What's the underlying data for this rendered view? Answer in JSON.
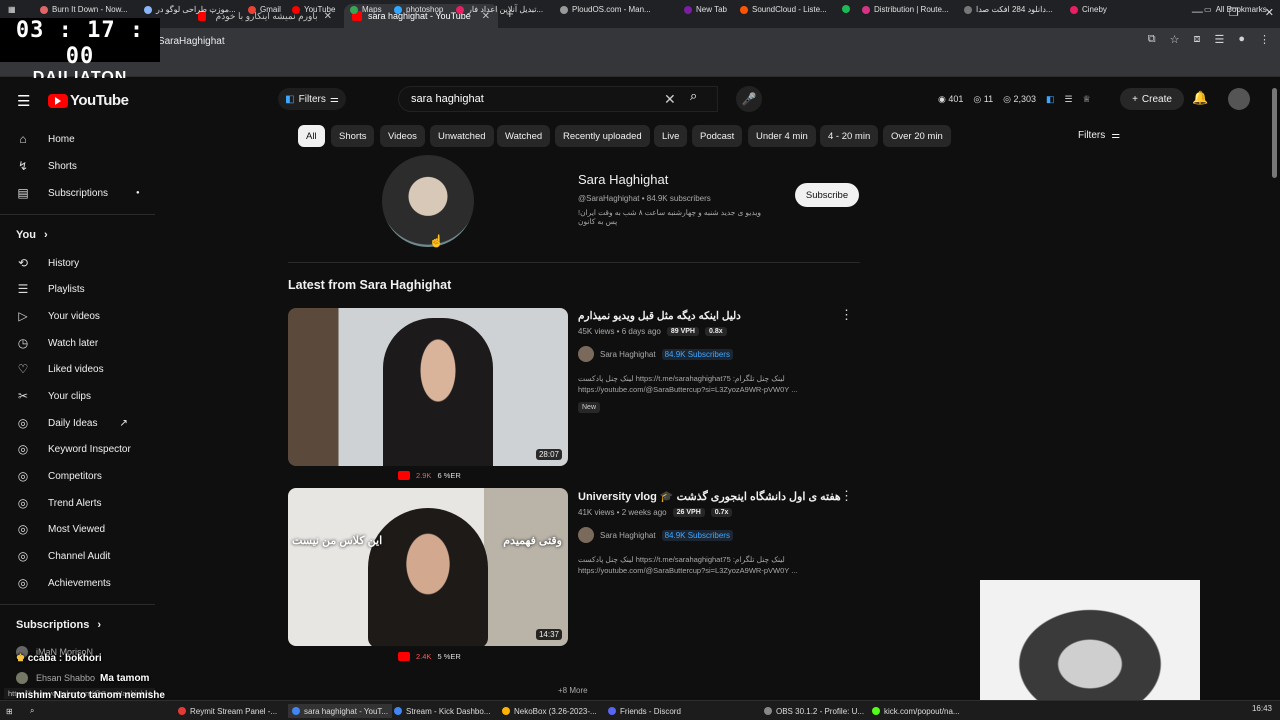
{
  "browser": {
    "tabs": [
      {
        "label": "باورم نمیشه اینکارو با خودم کرد..."
      },
      {
        "label": "sara haghighat - YouTube"
      }
    ],
    "new_tab": "+",
    "url": "/@SaraHaghighat",
    "bookmarks": [
      "Burn It Down - Now...",
      "موزت طراحی لوگو در...",
      "Gmail",
      "YouTube",
      "Maps",
      "photoshop",
      "تبدیل آنلاین اعداد فار...",
      "PloudOS.com - Man...",
      "New Tab",
      "SoundCloud - Liste...",
      "Distribution | Route...",
      "دانلود 284 افکت صدا...",
      "Cineby"
    ],
    "all_bookmarks": "All Bookmarks"
  },
  "overlay": {
    "timer": "03 : 17 : 00",
    "label": "DAILIATON"
  },
  "header": {
    "logo": "YouTube",
    "filters_btn": "Filters",
    "search_value": "sara haghighat",
    "stats": [
      "401",
      "11",
      "2,303"
    ],
    "create": "Create"
  },
  "sidebar": {
    "main": [
      {
        "label": "Home",
        "icon": "home-icon",
        "glyph": "⌂"
      },
      {
        "label": "Shorts",
        "icon": "shorts-icon",
        "glyph": "↯"
      },
      {
        "label": "Subscriptions",
        "icon": "subscriptions-icon",
        "glyph": "▤"
      }
    ],
    "you_header": "You",
    "you": [
      {
        "label": "History",
        "glyph": "⟲"
      },
      {
        "label": "Playlists",
        "glyph": "☰"
      },
      {
        "label": "Your videos",
        "glyph": "▷"
      },
      {
        "label": "Watch later",
        "glyph": "◷"
      },
      {
        "label": "Liked videos",
        "glyph": "👍"
      },
      {
        "label": "Your clips",
        "glyph": "✂"
      },
      {
        "label": "Daily Ideas",
        "glyph": "◎"
      },
      {
        "label": "Keyword Inspector",
        "glyph": "◎"
      },
      {
        "label": "Competitors",
        "glyph": "◎"
      },
      {
        "label": "Trend Alerts",
        "glyph": "◎"
      },
      {
        "label": "Most Viewed",
        "glyph": "◎"
      },
      {
        "label": "Channel Audit",
        "glyph": "◎"
      },
      {
        "label": "Achievements",
        "glyph": "◎"
      }
    ],
    "subs_header": "Subscriptions",
    "sub_item": "iMaN MorisoN",
    "sub_item2": "Ehsan Shabbo"
  },
  "chips": [
    "All",
    "Shorts",
    "Videos",
    "Unwatched",
    "Watched",
    "Recently uploaded",
    "Live",
    "Podcast",
    "Under 4 min",
    "4 - 20 min",
    "Over 20 min"
  ],
  "filters_right": "Filters",
  "channel": {
    "name": "Sara Haghighat",
    "meta": "@SaraHaghighat • 84.9K subscribers",
    "desc": "ویدیو ی جدید شنبه و چهارشنبه ساعت ۸ شب به وقت ایران! پس به کانون",
    "subscribe": "Subscribe"
  },
  "latest_title": "Latest from Sara Haghighat",
  "videos": [
    {
      "title": "دلیل اینکه دیگه مثل قبل ویدیو نمیذارم",
      "views": "45K views • 6 days ago",
      "vph": "89 VPH",
      "ratio": "0.8x",
      "channel": "Sara Haghighat",
      "subs": "84.9K Subscribers",
      "desc1": "لینک چنل پادکست https://t.me/sarahaghighat75 :لینک چنل تلگرام",
      "desc2": "https://youtube.com/@SaraButtercup?si=L3ZyozA9WR-pVW0Y ...",
      "badge": "New",
      "duration": "28:07",
      "stat_views": "2.9K",
      "stat_er": "6 %ER"
    },
    {
      "title": "University vlog 🎓 هفته ی اول دانشگاه اینجوری گذشت",
      "views": "41K views • 2 weeks ago",
      "vph": "26 VPH",
      "ratio": "0.7x",
      "channel": "Sara Haghighat",
      "subs": "84.9K Subscribers",
      "desc1": "لینک چنل پادکست https://t.me/sarahaghighat75 :لینک چنل تلگرام",
      "desc2": "https://youtube.com/@SaraButtercup?si=L3ZyozA9WR-pVW0Y ...",
      "duration": "14:37",
      "stat_views": "2.4K",
      "stat_er": "5 %ER",
      "caption_left": "این کلاس من نیست",
      "caption_right": "وقتی فهمیدم"
    }
  ],
  "more_results": "+8 More",
  "chat": [
    "ccaba : bokhori",
    "Ma tamom",
    "mishim Naruto tamom nemishe"
  ],
  "status_url": "https://www.youtube.com/@SaraHaghighat",
  "taskbar": [
    "Reymit Stream Panel -...",
    "sara haghighat - YouT...",
    "Stream - Kick Dashbo...",
    "NekoBox (3.26-2023-...",
    "Friends - Discord",
    "OBS 30.1.2 - Profile: U...",
    "kick.com/popout/na..."
  ],
  "clock": "16:43"
}
